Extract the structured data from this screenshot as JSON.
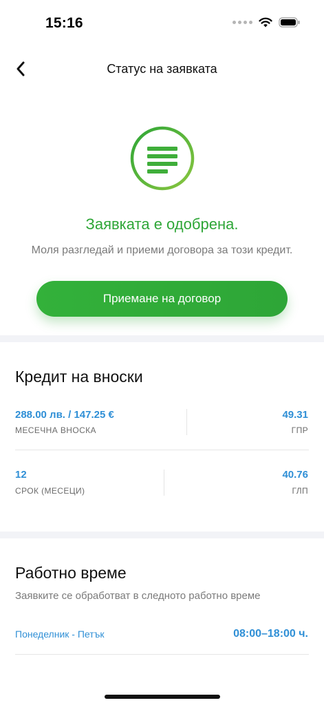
{
  "status_bar": {
    "time": "15:16"
  },
  "nav": {
    "title": "Статус на заявката",
    "back_icon": "chevron-left-icon"
  },
  "status": {
    "title": "Заявката е одобрена.",
    "subtitle": "Моля разгледай и приеми договора за този кредит.",
    "accept_button": "Приемане на договор",
    "icon": "approved-list-icon",
    "accent": "#2ea637"
  },
  "credit": {
    "title": "Кредит на вноски",
    "monthly_value": "288.00 лв. / 147.25 €",
    "monthly_label": "МЕСЕЧНА ВНОСКА",
    "gpr_value": "49.31",
    "gpr_label": "ГПР",
    "term_value": "12",
    "term_label": "СРОК (МЕСЕЦИ)",
    "glp_value": "40.76",
    "glp_label": "ГЛП",
    "value_color": "#2f8fd6"
  },
  "hours": {
    "title": "Работно време",
    "subtitle": "Заявките се обработват в следното работно време",
    "days": "Понеделник - Петък",
    "time": "08:00–18:00 ч."
  }
}
